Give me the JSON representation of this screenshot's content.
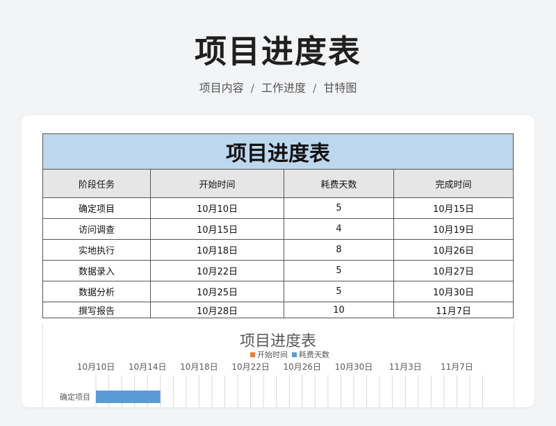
{
  "page": {
    "title": "项目进度表",
    "breadcrumbs": [
      "项目内容",
      "工作进度",
      "甘特图"
    ],
    "separator": "/"
  },
  "sheet": {
    "title": "项目进度表",
    "headers": [
      "阶段任务",
      "开始时间",
      "耗费天数",
      "完成时间"
    ],
    "rows": [
      [
        "确定项目",
        "10月10日",
        "5",
        "10月15日"
      ],
      [
        "访问调查",
        "10月15日",
        "4",
        "10月19日"
      ],
      [
        "实地执行",
        "10月18日",
        "8",
        "10月26日"
      ],
      [
        "数据录入",
        "10月22日",
        "5",
        "10月27日"
      ],
      [
        "数据分析",
        "10月25日",
        "5",
        "10月30日"
      ],
      [
        "撰写报告",
        "10月28日",
        "10",
        "11月7日"
      ]
    ]
  },
  "chart_data": {
    "type": "bar",
    "orientation": "horizontal-stacked",
    "title": "项目进度表",
    "legend": [
      "开始时间",
      "耗费天数"
    ],
    "legend_placement": "top",
    "x_ticks": [
      "10月10日",
      "10月14日",
      "10月18日",
      "10月22日",
      "10月26日",
      "10月30日",
      "11月3日",
      "11月7日"
    ],
    "categories": [
      "确定项目"
    ],
    "series": [
      {
        "name": "开始时间",
        "values": [
          "10月10日"
        ]
      },
      {
        "name": "耗费天数",
        "values": [
          5
        ]
      }
    ],
    "colors": {
      "start": "#ed7d31",
      "duration": "#5b9bd5",
      "grid": "#d9d9d9",
      "title": "#595959",
      "text": "#595959"
    }
  }
}
